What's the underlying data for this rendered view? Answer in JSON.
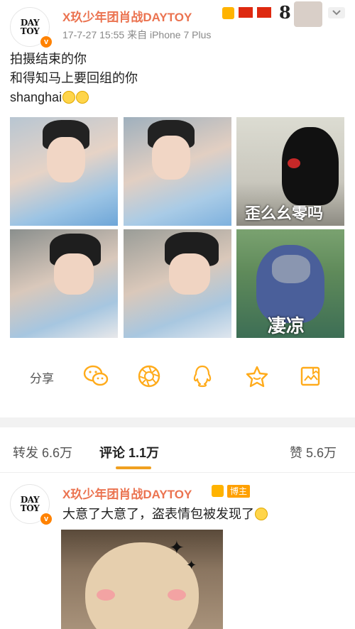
{
  "post": {
    "avatar_text_line1": "DAY",
    "avatar_text_line2": "TOY",
    "verified_icon": "v-badge-icon",
    "username": "X玖少年团肖战DAYTOY",
    "meta": "17-7-27 15:55  来自 iPhone 7 Plus",
    "lines": [
      "拍摄结束的你",
      "和得知马上要回组的你",
      "shanghai"
    ],
    "images": [
      {
        "name": "photo-1",
        "caption": ""
      },
      {
        "name": "photo-2",
        "caption": ""
      },
      {
        "name": "photo-3",
        "caption": "歪么幺零吗"
      },
      {
        "name": "photo-4",
        "caption": ""
      },
      {
        "name": "photo-5",
        "caption": ""
      },
      {
        "name": "photo-6",
        "caption": "凄凉"
      }
    ]
  },
  "actions": {
    "share_label": "分享",
    "icons": [
      "wechat-icon",
      "moments-icon",
      "qq-icon",
      "star-icon",
      "save-image-icon"
    ]
  },
  "tabs": {
    "repost": "转发 6.6万",
    "comments": "评论 1.1万",
    "likes": "赞 5.6万"
  },
  "comment": {
    "avatar_text_line1": "DAY",
    "avatar_text_line2": "TOY",
    "username": "X玖少年团肖战DAYTOY",
    "badge": "博主",
    "text": "大意了大意了，盗表情包被发现了"
  },
  "colors": {
    "username": "#eb7350",
    "accent": "#ffab1b",
    "tab_underline": "#f0a020",
    "verified": "#ff8200"
  }
}
